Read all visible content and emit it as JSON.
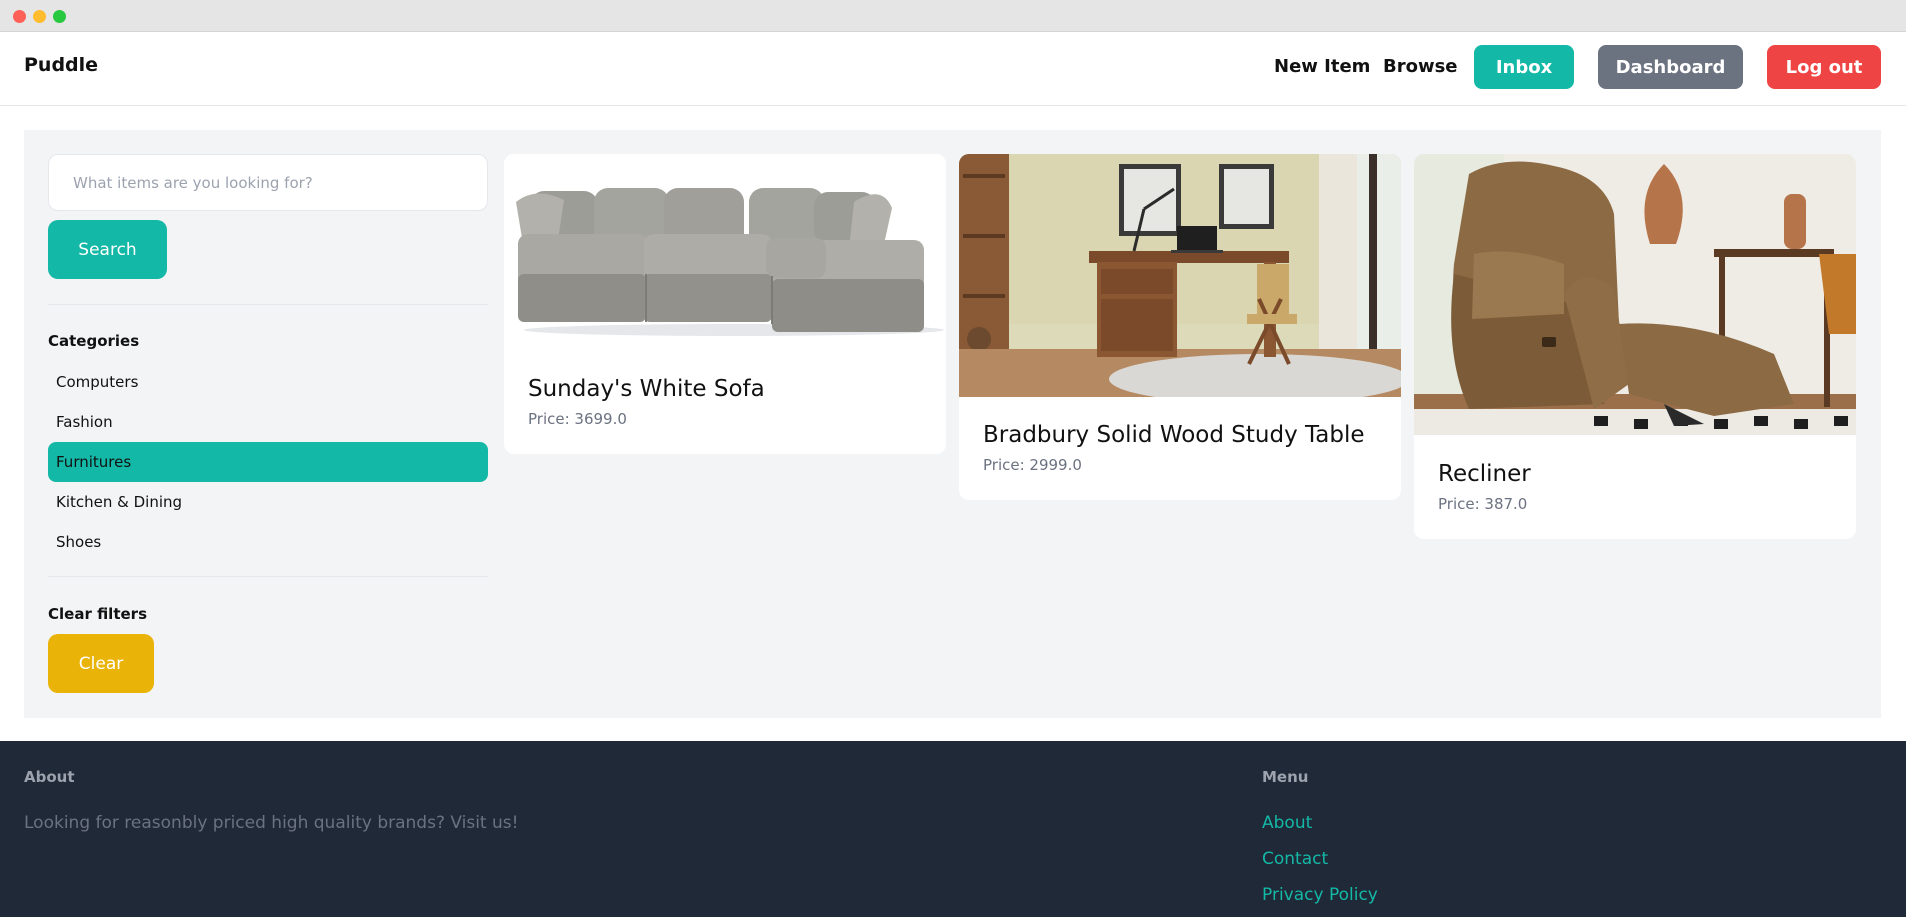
{
  "navbar": {
    "brand": "Puddle",
    "new_item": "New Item",
    "browse": "Browse",
    "inbox": "Inbox",
    "dashboard": "Dashboard",
    "logout": "Log out"
  },
  "sidebar": {
    "search": {
      "placeholder": "What items are you looking for?",
      "value": ""
    },
    "search_label": "Search",
    "categories_title": "Categories",
    "categories": [
      {
        "label": "Computers",
        "active": false
      },
      {
        "label": "Fashion",
        "active": false
      },
      {
        "label": "Furnitures",
        "active": true
      },
      {
        "label": "Kitchen & Dining",
        "active": false
      },
      {
        "label": "Shoes",
        "active": false
      }
    ],
    "clear_title": "Clear filters",
    "clear_label": "Clear"
  },
  "items": [
    {
      "name": "Sunday's White Sofa",
      "price": "Price: 3699.0"
    },
    {
      "name": "Bradbury Solid Wood Study Table",
      "price": "Price: 2999.0"
    },
    {
      "name": "Recliner",
      "price": "Price: 387.0"
    }
  ],
  "footer": {
    "about_title": "About",
    "about_text": "Looking for reasonbly priced high quality brands? Visit us!",
    "menu_title": "Menu",
    "links": [
      "About",
      "Contact",
      "Privacy Policy"
    ]
  },
  "colors": {
    "accent": "#14b8a6",
    "dashboard": "#6b7280",
    "logout": "#ef4444",
    "clear": "#eab308",
    "footer_bg": "#1f2937"
  }
}
